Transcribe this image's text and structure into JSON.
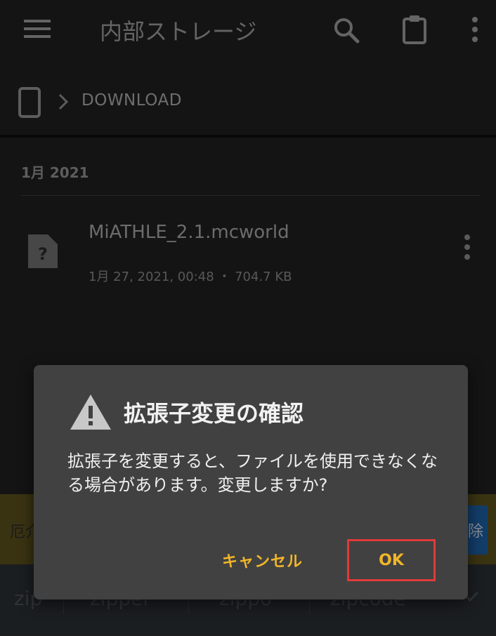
{
  "appbar": {
    "title": "内部ストレージ",
    "icons": [
      "menu-icon",
      "search-icon",
      "clipboard-icon",
      "more-vert-icon"
    ]
  },
  "breadcrumb": {
    "device_icon": "phone-icon",
    "folder": "DOWNLOAD"
  },
  "file_list": {
    "section_header": "1月 2021",
    "files": [
      {
        "name": "MiATHLE_2.1.mcworld",
        "meta": "1月 27, 2021, 00:48 ・ 704.7 KB",
        "icon": "unknown-file-icon"
      }
    ]
  },
  "notice": {
    "text": "厄介",
    "button": "除"
  },
  "keyboard_suggestions": [
    "zip",
    "zipper",
    "zippo",
    "zipcode"
  ],
  "dialog": {
    "title": "拡張子変更の確認",
    "icon": "warning-icon",
    "message": "拡張子を変更すると、ファイルを使用できなくなる場合があります。変更しますか?",
    "cancel_label": "キャンセル",
    "ok_label": "OK"
  },
  "colors": {
    "accent": "#f2b62a",
    "highlight": "#e03a3a",
    "dialog_bg": "#414141"
  }
}
